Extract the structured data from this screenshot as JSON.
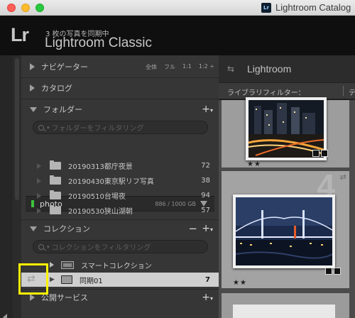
{
  "window": {
    "title": "Lightroom Catalog"
  },
  "identity_plate": {
    "logo": "Lr",
    "status": "3 枚の写真を同期中",
    "app_name": "Lightroom Classic"
  },
  "panels": {
    "navigator": {
      "label": "ナビゲーター",
      "modes": [
        "全体",
        "フル",
        "1:1",
        "1:2 ÷"
      ]
    },
    "catalog": {
      "label": "カタログ"
    },
    "folders": {
      "label": "フォルダー",
      "add_label": "+",
      "filter_placeholder": "フォルダーをフィルタリング",
      "volume": {
        "name": "photo",
        "size": "886 / 1000 GB"
      },
      "items": [
        {
          "name": "20190313都庁夜景",
          "count": "72"
        },
        {
          "name": "20190430東京駅リフ写真",
          "count": "38"
        },
        {
          "name": "20190510台場夜",
          "count": "94"
        },
        {
          "name": "20190530狭山湖朝",
          "count": "57"
        }
      ]
    },
    "collections": {
      "label": "コレクション",
      "remove_label": "−",
      "add_label": "+",
      "filter_placeholder": "コレクションをフィルタリング",
      "items": [
        {
          "name": "スマートコレクション",
          "count": ""
        },
        {
          "name": "同期01",
          "count": "7"
        }
      ]
    },
    "publish": {
      "label": "公開サービス",
      "add_label": "+"
    }
  },
  "right": {
    "header_title": "Lightroom",
    "filter_bar": "ライブラリフィルター：",
    "filter_more": "テ",
    "grid": {
      "cells": [
        {
          "rating": "★★"
        },
        {
          "rating": "★★",
          "number": "4"
        }
      ]
    }
  },
  "icons": {
    "sync": "sync-arrows-icon",
    "collapse": "triangle-icon",
    "search": "search-icon",
    "folder": "folder-icon"
  },
  "colors": {
    "highlight": "#fff200",
    "volume_led": "#3ec43e",
    "selected_row": "#cfcfcf"
  }
}
